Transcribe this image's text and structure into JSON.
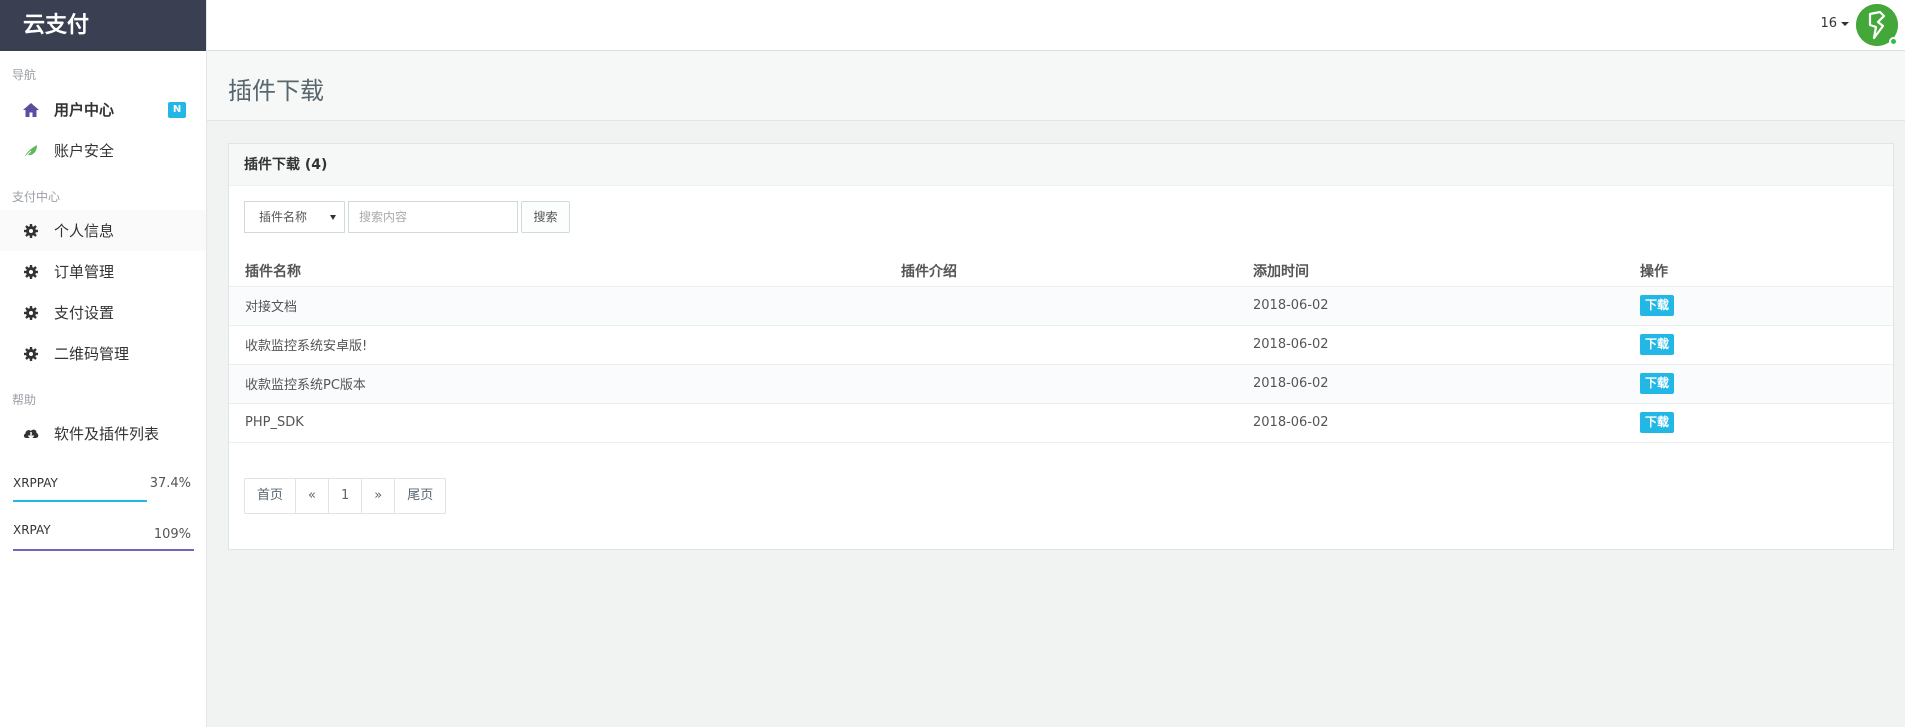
{
  "brand": "云支付",
  "header": {
    "user": "16"
  },
  "sidebar": {
    "sections": [
      {
        "title": "导航"
      },
      {
        "title": "支付中心"
      },
      {
        "title": "帮助"
      }
    ],
    "items": [
      {
        "label": "用户中心",
        "icon": "home-icon",
        "badge": "N"
      },
      {
        "label": "账户安全",
        "icon": "leaf-icon"
      },
      {
        "label": "个人信息",
        "icon": "gear-icon"
      },
      {
        "label": "订单管理",
        "icon": "gear-icon"
      },
      {
        "label": "支付设置",
        "icon": "gear-icon"
      },
      {
        "label": "二维码管理",
        "icon": "gear-icon"
      },
      {
        "label": "软件及插件列表",
        "icon": "cloud-download-icon"
      }
    ],
    "progress": [
      {
        "label": "XRPPAY",
        "value": "37.4%",
        "fraction": 0.74,
        "color": "#23b7e5"
      },
      {
        "label": "XRPAY",
        "value": "109%",
        "fraction": 1.0,
        "color": "#7266ba"
      }
    ]
  },
  "page": {
    "title": "插件下载"
  },
  "panel": {
    "title": "插件下载 (4)",
    "search": {
      "select_value": "插件名称",
      "placeholder": "搜索内容",
      "button": "搜索"
    },
    "table": {
      "headers": [
        "插件名称",
        "插件介绍",
        "添加时间",
        "操作"
      ],
      "rows": [
        {
          "name": "对接文档",
          "intro": "",
          "date": "2018-06-02",
          "action": "下载"
        },
        {
          "name": "收款监控系统安卓版!",
          "intro": "",
          "date": "2018-06-02",
          "action": "下载"
        },
        {
          "name": "收款监控系统PC版本",
          "intro": "",
          "date": "2018-06-02",
          "action": "下载"
        },
        {
          "name": "PHP_SDK",
          "intro": "",
          "date": "2018-06-02",
          "action": "下载"
        }
      ]
    },
    "pagination": [
      "首页",
      "«",
      "1",
      "»",
      "尾页"
    ]
  },
  "colors": {
    "brand_bg": "#3a3f51",
    "accent": "#23b7e5",
    "purple": "#7266ba",
    "avatar": "#43a839"
  }
}
